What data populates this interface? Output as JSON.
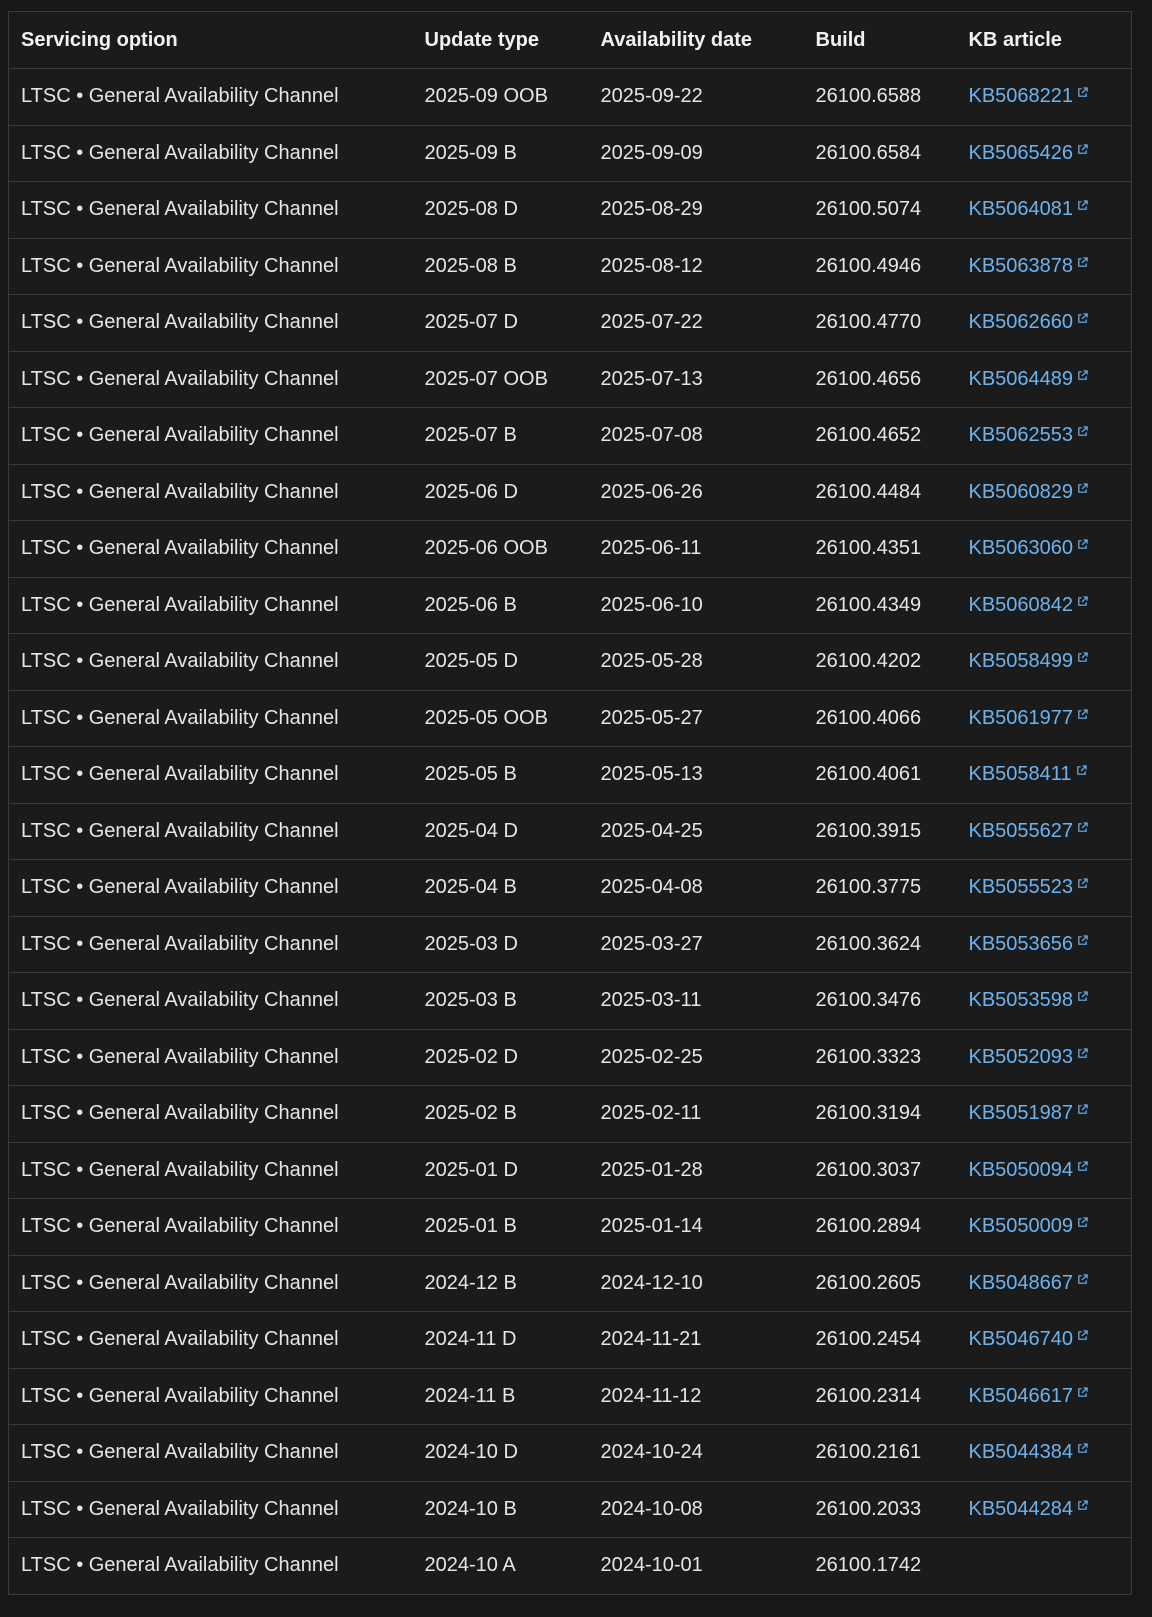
{
  "table": {
    "headers": [
      "Servicing option",
      "Update type",
      "Availability date",
      "Build",
      "KB article"
    ],
    "rows": [
      {
        "servicing": "LTSC • General Availability Channel",
        "update": "2025-09 OOB",
        "date": "2025-09-22",
        "build": "26100.6588",
        "kb": "KB5068221"
      },
      {
        "servicing": "LTSC • General Availability Channel",
        "update": "2025-09 B",
        "date": "2025-09-09",
        "build": "26100.6584",
        "kb": "KB5065426"
      },
      {
        "servicing": "LTSC • General Availability Channel",
        "update": "2025-08 D",
        "date": "2025-08-29",
        "build": "26100.5074",
        "kb": "KB5064081"
      },
      {
        "servicing": "LTSC • General Availability Channel",
        "update": "2025-08 B",
        "date": "2025-08-12",
        "build": "26100.4946",
        "kb": "KB5063878"
      },
      {
        "servicing": "LTSC • General Availability Channel",
        "update": "2025-07 D",
        "date": "2025-07-22",
        "build": "26100.4770",
        "kb": "KB5062660"
      },
      {
        "servicing": "LTSC • General Availability Channel",
        "update": "2025-07 OOB",
        "date": "2025-07-13",
        "build": "26100.4656",
        "kb": "KB5064489"
      },
      {
        "servicing": "LTSC • General Availability Channel",
        "update": "2025-07 B",
        "date": "2025-07-08",
        "build": "26100.4652",
        "kb": "KB5062553"
      },
      {
        "servicing": "LTSC • General Availability Channel",
        "update": "2025-06 D",
        "date": "2025-06-26",
        "build": "26100.4484",
        "kb": "KB5060829"
      },
      {
        "servicing": "LTSC • General Availability Channel",
        "update": "2025-06 OOB",
        "date": "2025-06-11",
        "build": "26100.4351",
        "kb": "KB5063060"
      },
      {
        "servicing": "LTSC • General Availability Channel",
        "update": "2025-06 B",
        "date": "2025-06-10",
        "build": "26100.4349",
        "kb": "KB5060842"
      },
      {
        "servicing": "LTSC • General Availability Channel",
        "update": "2025-05 D",
        "date": "2025-05-28",
        "build": "26100.4202",
        "kb": "KB5058499"
      },
      {
        "servicing": "LTSC • General Availability Channel",
        "update": "2025-05 OOB",
        "date": "2025-05-27",
        "build": "26100.4066",
        "kb": "KB5061977"
      },
      {
        "servicing": "LTSC • General Availability Channel",
        "update": "2025-05 B",
        "date": "2025-05-13",
        "build": "26100.4061",
        "kb": "KB5058411"
      },
      {
        "servicing": "LTSC • General Availability Channel",
        "update": "2025-04 D",
        "date": "2025-04-25",
        "build": "26100.3915",
        "kb": "KB5055627"
      },
      {
        "servicing": "LTSC • General Availability Channel",
        "update": "2025-04 B",
        "date": "2025-04-08",
        "build": "26100.3775",
        "kb": "KB5055523"
      },
      {
        "servicing": "LTSC • General Availability Channel",
        "update": "2025-03 D",
        "date": "2025-03-27",
        "build": "26100.3624",
        "kb": "KB5053656"
      },
      {
        "servicing": "LTSC • General Availability Channel",
        "update": "2025-03 B",
        "date": "2025-03-11",
        "build": "26100.3476",
        "kb": "KB5053598"
      },
      {
        "servicing": "LTSC • General Availability Channel",
        "update": "2025-02 D",
        "date": "2025-02-25",
        "build": "26100.3323",
        "kb": "KB5052093"
      },
      {
        "servicing": "LTSC • General Availability Channel",
        "update": "2025-02 B",
        "date": "2025-02-11",
        "build": "26100.3194",
        "kb": "KB5051987"
      },
      {
        "servicing": "LTSC • General Availability Channel",
        "update": "2025-01 D",
        "date": "2025-01-28",
        "build": "26100.3037",
        "kb": "KB5050094"
      },
      {
        "servicing": "LTSC • General Availability Channel",
        "update": "2025-01 B",
        "date": "2025-01-14",
        "build": "26100.2894",
        "kb": "KB5050009"
      },
      {
        "servicing": "LTSC • General Availability Channel",
        "update": "2024-12 B",
        "date": "2024-12-10",
        "build": "26100.2605",
        "kb": "KB5048667"
      },
      {
        "servicing": "LTSC • General Availability Channel",
        "update": "2024-11 D",
        "date": "2024-11-21",
        "build": "26100.2454",
        "kb": "KB5046740"
      },
      {
        "servicing": "LTSC • General Availability Channel",
        "update": "2024-11 B",
        "date": "2024-11-12",
        "build": "26100.2314",
        "kb": "KB5046617"
      },
      {
        "servicing": "LTSC • General Availability Channel",
        "update": "2024-10 D",
        "date": "2024-10-24",
        "build": "26100.2161",
        "kb": "KB5044384"
      },
      {
        "servicing": "LTSC • General Availability Channel",
        "update": "2024-10 B",
        "date": "2024-10-08",
        "build": "26100.2033",
        "kb": "KB5044284"
      },
      {
        "servicing": "LTSC • General Availability Channel",
        "update": "2024-10 A",
        "date": "2024-10-01",
        "build": "26100.1742",
        "kb": ""
      }
    ]
  },
  "icons": {
    "external_link": "external-link-icon"
  },
  "colors": {
    "link": "#6cb4f0",
    "background": "#1b1b1b",
    "border": "#3a3a3a"
  }
}
